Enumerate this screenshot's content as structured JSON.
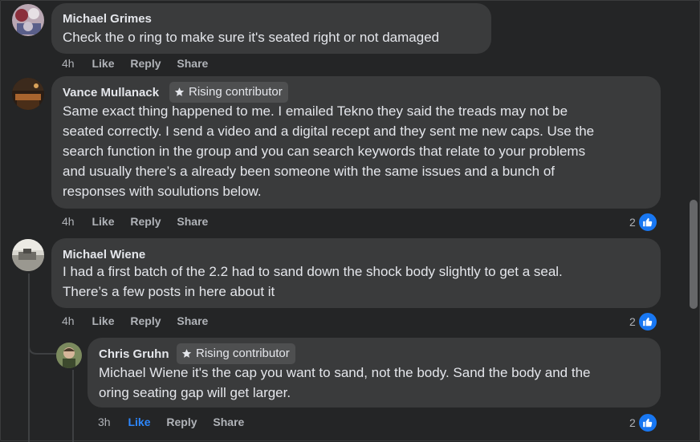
{
  "colors": {
    "background": "#242526",
    "bubble": "#3a3b3c",
    "accent_like": "#2d88ff"
  },
  "comments": [
    {
      "author": "Michael Grimes",
      "text_lines": [
        "Check the o ring to make sure it's seated right or not damaged"
      ],
      "time": "4h",
      "like": "Like",
      "reply": "Reply",
      "share": "Share"
    },
    {
      "author": "Vance Mullanack",
      "badge": "Rising contributor",
      "text_lines": [
        "Same exact thing happened to me. I emailed Tekno they said the treads may not be",
        "seated correctly. I send a video and a digital recept and they sent me new caps. Use the",
        "search function in the group and you can search keywords that relate to your problems",
        "and usually there’s a already been someone with the same issues and a bunch of",
        "responses with soulutions below."
      ],
      "time": "4h",
      "like": "Like",
      "reply": "Reply",
      "share": "Share",
      "reactions": "2",
      "reaction_icon": "thumbs-up-icon"
    },
    {
      "author": "Michael Wiene",
      "text_lines": [
        "I had a first batch of the 2.2 had to sand down the shock body slightly to get a seal.",
        "There’s a few posts in here about it"
      ],
      "time": "4h",
      "like": "Like",
      "reply": "Reply",
      "share": "Share",
      "reactions": "2",
      "reaction_icon": "thumbs-up-icon"
    },
    {
      "author": "Chris Gruhn",
      "badge": "Rising contributor",
      "text_lines": [
        "Michael Wiene it's the cap you want to sand, not the body. Sand the body and the",
        "oring seating gap will get larger."
      ],
      "time": "3h",
      "like": "Like",
      "reply": "Reply",
      "share": "Share",
      "liked_by_viewer": true,
      "reactions": "2",
      "reaction_icon": "thumbs-up-icon"
    }
  ]
}
